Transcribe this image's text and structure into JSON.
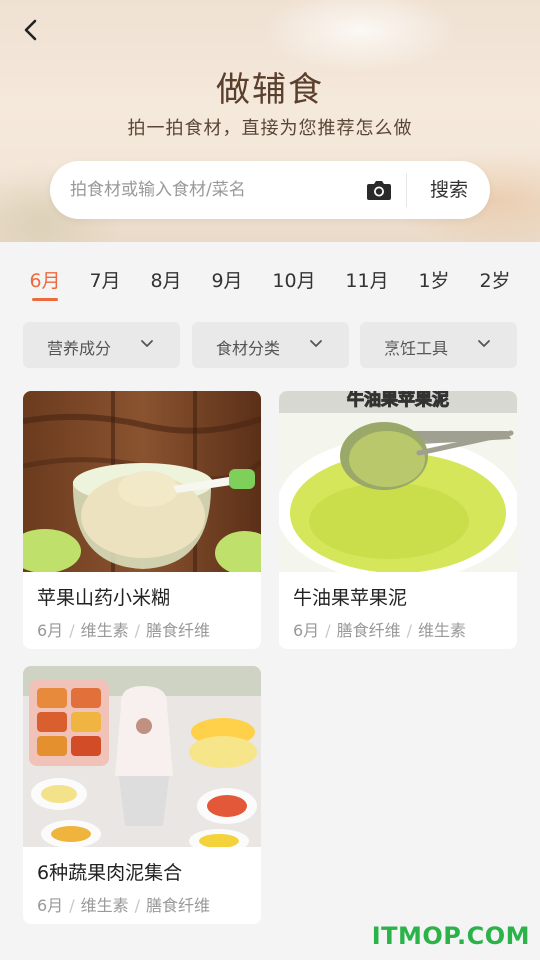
{
  "header": {
    "title": "做辅食",
    "subtitle": "拍一拍食材，直接为您推荐怎么做"
  },
  "search": {
    "placeholder": "拍食材或输入食材/菜名",
    "button_label": "搜索"
  },
  "tabs": [
    {
      "label": "6月",
      "active": true
    },
    {
      "label": "7月",
      "active": false
    },
    {
      "label": "8月",
      "active": false
    },
    {
      "label": "9月",
      "active": false
    },
    {
      "label": "10月",
      "active": false
    },
    {
      "label": "11月",
      "active": false
    },
    {
      "label": "1岁",
      "active": false
    },
    {
      "label": "2岁",
      "active": false
    }
  ],
  "filters": [
    {
      "label": "营养成分"
    },
    {
      "label": "食材分类"
    },
    {
      "label": "烹饪工具"
    }
  ],
  "recipes": [
    {
      "title": "苹果山药小米糊",
      "tags": [
        "6月",
        "维生素",
        "膳食纤维"
      ]
    },
    {
      "title": "牛油果苹果泥",
      "image_caption": "牛油果苹果泥",
      "tags": [
        "6月",
        "膳食纤维",
        "维生素"
      ]
    },
    {
      "title": "6种蔬果肉泥集合",
      "tags": [
        "6月",
        "维生素",
        "膳食纤维"
      ]
    }
  ],
  "watermark": "ITMOP.COM",
  "colors": {
    "accent": "#ee6a3c",
    "watermark": "#2bb34a"
  }
}
